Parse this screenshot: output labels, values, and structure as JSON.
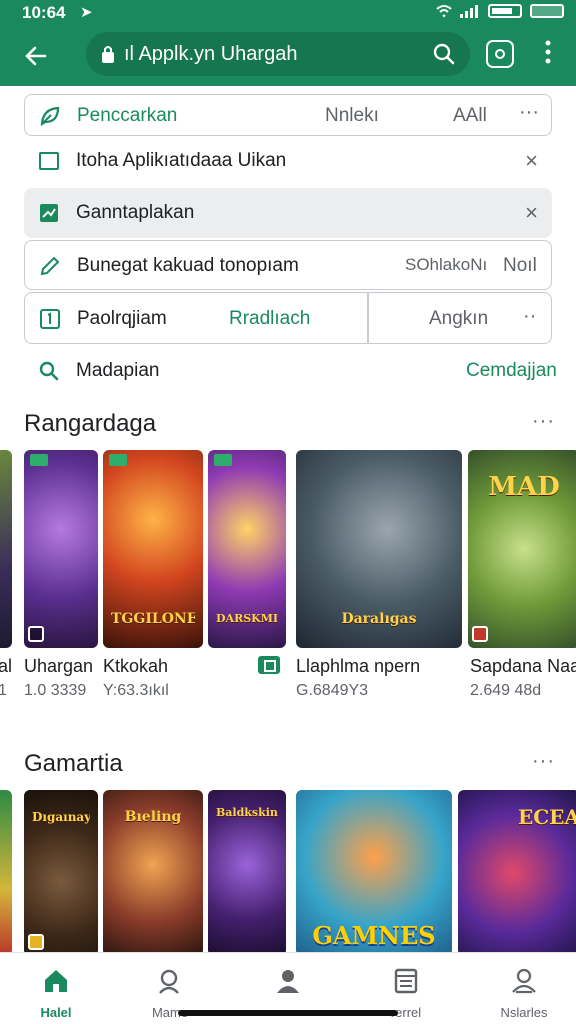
{
  "status_bar": {
    "time": "10:64",
    "arrow": "➤"
  },
  "app_bar": {
    "url": "ıl Applk.yn Uhargah"
  },
  "rows": [
    {
      "label": "Penccarkan",
      "mid": "Nnlekı",
      "right": "AAll",
      "more": "···"
    },
    {
      "label": "Itoha Aplikıatıdaaa Uikan",
      "close": "×"
    },
    {
      "label": "Ganntaplakan",
      "close": "×"
    },
    {
      "label": "Bunegat kakuad tonopıam",
      "mid": "SOhlakoNı",
      "right": "Noıl"
    },
    {
      "label": "Paolrqjiam",
      "mid": "Rradlıach",
      "right": "Angkın",
      "more": "··"
    },
    {
      "label": "Madapian",
      "right": "Cemdajjan"
    }
  ],
  "section1": {
    "title": "Rangardaga",
    "more": "···",
    "cards": [
      {
        "banner": ""
      },
      {
        "banner": "TGGILONE"
      },
      {
        "banner": "DARSKMINE"
      },
      {
        "banner": "Daralıgas"
      },
      {
        "banner": "MAD"
      }
    ],
    "games": [
      {
        "name": "Uhargan",
        "stat": "1.0 3339"
      },
      {
        "name": "Ktkokah",
        "stat": "Y:63.3ıkıl"
      },
      {
        "name": "Llaphlma npern",
        "stat": "G.6849Y3"
      },
      {
        "name": "Sapdana Naa",
        "stat": "2.649 48d"
      }
    ],
    "edge_name": "al",
    "edge_stat": "1"
  },
  "section2": {
    "title": "Gamartia",
    "more": "···",
    "cards": [
      {
        "banner": ""
      },
      {
        "banner": "Dıgaınay"
      },
      {
        "banner": "Bıeling"
      },
      {
        "banner": "Baldkskinl"
      },
      {
        "banner": "GAMNES"
      },
      {
        "banner": "ECEAR"
      }
    ]
  },
  "bottom_nav": [
    {
      "label": "Halel"
    },
    {
      "label": "Mame"
    },
    {
      "label": ""
    },
    {
      "label": "rerrel"
    },
    {
      "label": "Nslarles"
    }
  ],
  "colors": {
    "accent": "#1a8a5e",
    "bar": "#1a8a5e",
    "urlbox": "#15764f"
  }
}
